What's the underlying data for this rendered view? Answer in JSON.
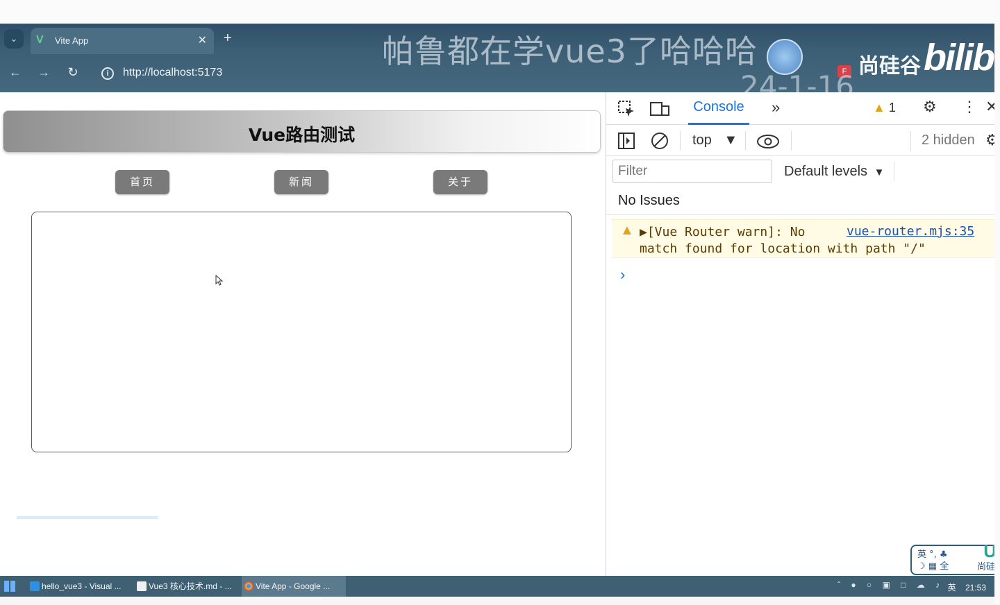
{
  "browser": {
    "tab_title": "Vite App",
    "new_tab_symbol": "+",
    "url": "http://localhost:5173"
  },
  "overlay": {
    "title": "帕鲁都在学vue3了哈哈哈",
    "date": "24-1-16",
    "brand": "尚硅谷",
    "brand_logo": "bilibili"
  },
  "page": {
    "header_title": "Vue路由测试",
    "nav": [
      {
        "label": "首页"
      },
      {
        "label": "新闻"
      },
      {
        "label": "关于"
      }
    ]
  },
  "devtools": {
    "tab_console": "Console",
    "warning_count": "1",
    "context": "top",
    "hidden": "2 hidden",
    "filter_placeholder": "Filter",
    "levels": "Default levels",
    "no_issues": "No Issues",
    "message_line1": "[Vue Router warn]: No",
    "message_line2": "match found for location with path \"/\"",
    "message_source": "vue-router.mjs:35"
  },
  "ime": {
    "line1": "英 °, ♣",
    "line2": "☽ ▦ 全",
    "brand": "尚硅"
  },
  "taskbar": {
    "items": [
      {
        "label": "hello_vue3 - Visual ..."
      },
      {
        "label": "Vue3 核心技术.md - ..."
      },
      {
        "label": "Vite App - Google ..."
      }
    ],
    "lang": "英",
    "time": "21:53"
  },
  "colors": {
    "chrome": "#3d5f76",
    "nav_button": "#7a7a7a",
    "devtools_accent": "#1a73e8",
    "warning_bg": "#fffbe5"
  }
}
